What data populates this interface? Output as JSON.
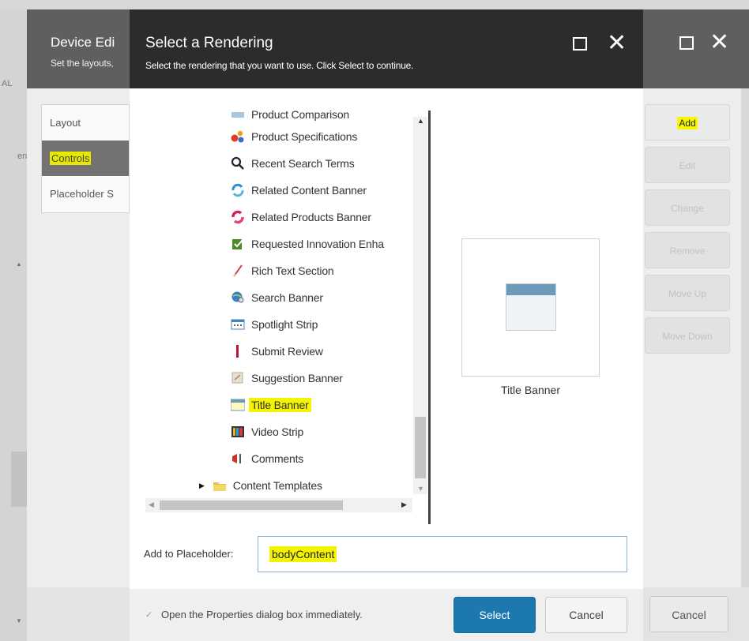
{
  "background_window": {
    "title": "Device Edi",
    "subtitle": "Set the layouts,",
    "left_edge_text": "AL",
    "left_edge_text2": "en",
    "nav": [
      {
        "label": "Layout",
        "active": false
      },
      {
        "label": "Controls",
        "active": true
      },
      {
        "label": "Placeholder S",
        "active": false
      }
    ],
    "buttons": [
      {
        "label": "Add",
        "enabled": true
      },
      {
        "label": "Edit",
        "enabled": false
      },
      {
        "label": "Change",
        "enabled": false
      },
      {
        "label": "Remove",
        "enabled": false
      },
      {
        "label": "Move Up",
        "enabled": false
      },
      {
        "label": "Move Down",
        "enabled": false
      }
    ],
    "cancel_label": "Cancel",
    "maximize_icon": "maximize-icon",
    "close_icon": "close-icon"
  },
  "dialog": {
    "title": "Select a Rendering",
    "subtitle": "Select the rendering that you want to use. Click Select to continue.",
    "tree": {
      "items": [
        {
          "label": "Product Comparison",
          "icon": "comparison-icon"
        },
        {
          "label": "Product Specifications",
          "icon": "specifications-icon"
        },
        {
          "label": "Recent Search Terms",
          "icon": "search-icon"
        },
        {
          "label": "Related Content Banner",
          "icon": "related-content-icon"
        },
        {
          "label": "Related Products Banner",
          "icon": "related-products-icon"
        },
        {
          "label": "Requested Innovation Enha",
          "icon": "checklist-icon"
        },
        {
          "label": "Rich Text Section",
          "icon": "pen-icon"
        },
        {
          "label": "Search Banner",
          "icon": "globe-search-icon"
        },
        {
          "label": "Spotlight Strip",
          "icon": "spotlight-strip-icon"
        },
        {
          "label": "Submit Review",
          "icon": "submit-review-icon"
        },
        {
          "label": "Suggestion Banner",
          "icon": "suggestion-icon"
        },
        {
          "label": "Title Banner",
          "icon": "title-banner-icon",
          "selected": true
        },
        {
          "label": "Video Strip",
          "icon": "video-strip-icon"
        },
        {
          "label": "Comments",
          "icon": "comments-icon"
        },
        {
          "label": "Content Templates",
          "icon": "folder-icon",
          "folder": true
        }
      ]
    },
    "preview": {
      "label": "Title Banner"
    },
    "placeholder": {
      "label": "Add to Placeholder:",
      "value": "bodyContent"
    },
    "footer": {
      "checkbox_label": "Open the Properties dialog box immediately.",
      "select_label": "Select",
      "cancel_label": "Cancel"
    }
  },
  "colors": {
    "highlight": "#f4f400",
    "primary_button": "#1e78b0",
    "dialog_header": "#2c2c2c",
    "bg_header": "#5f5f5f"
  }
}
